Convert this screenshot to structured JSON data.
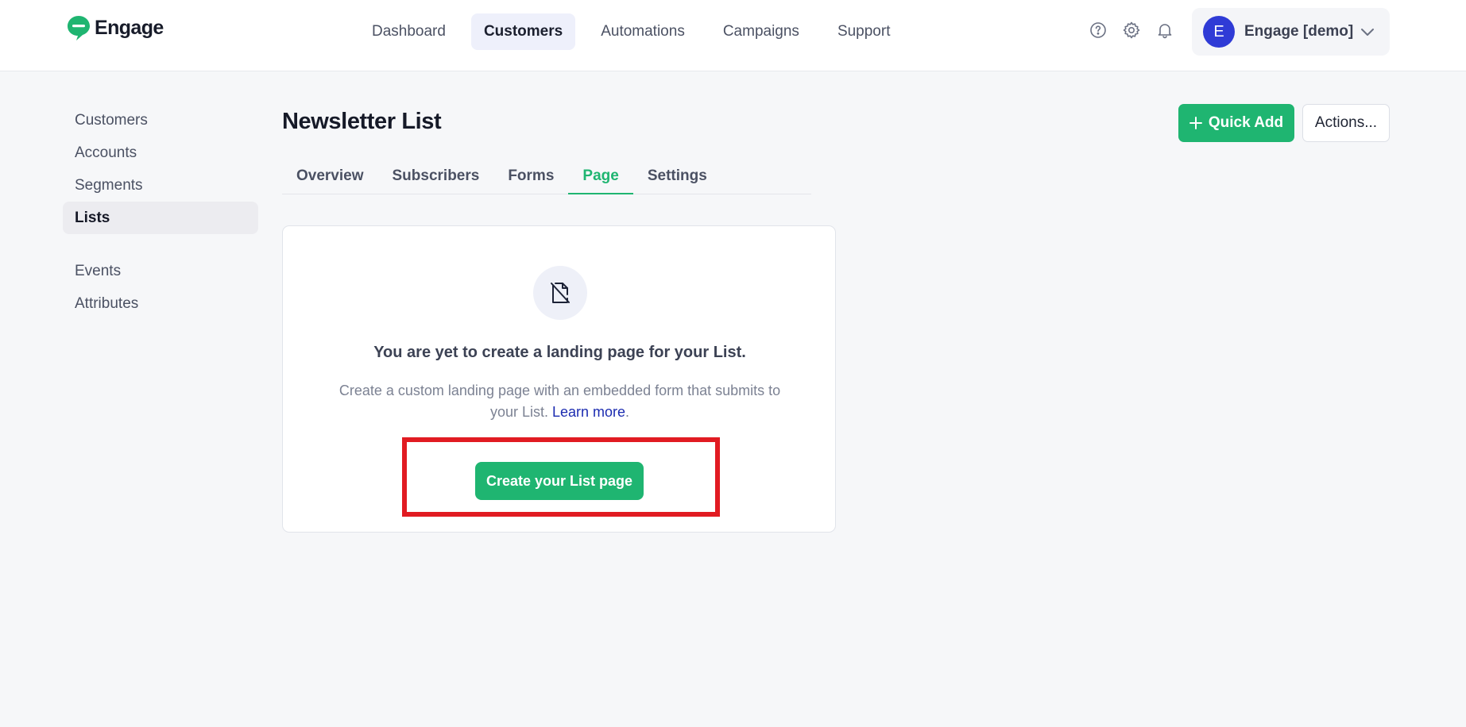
{
  "brand": {
    "name": "Engage",
    "color": "#1fb571"
  },
  "topnav": {
    "items": [
      {
        "label": "Dashboard",
        "active": false
      },
      {
        "label": "Customers",
        "active": true
      },
      {
        "label": "Automations",
        "active": false
      },
      {
        "label": "Campaigns",
        "active": false
      },
      {
        "label": "Support",
        "active": false
      }
    ]
  },
  "header_icons": [
    "help-icon",
    "gear-icon",
    "bell-icon"
  ],
  "account": {
    "initial": "E",
    "name": "Engage [demo]",
    "avatar_color": "#2f3bd6"
  },
  "sidebar": {
    "items": [
      {
        "label": "Customers",
        "active": false
      },
      {
        "label": "Accounts",
        "active": false
      },
      {
        "label": "Segments",
        "active": false
      },
      {
        "label": "Lists",
        "active": true
      }
    ],
    "secondary": [
      {
        "label": "Events"
      },
      {
        "label": "Attributes"
      }
    ]
  },
  "page": {
    "title": "Newsletter List",
    "quick_add_label": "Quick Add",
    "actions_label": "Actions..."
  },
  "tabs": [
    {
      "label": "Overview",
      "active": false
    },
    {
      "label": "Subscribers",
      "active": false
    },
    {
      "label": "Forms",
      "active": false
    },
    {
      "label": "Page",
      "active": true
    },
    {
      "label": "Settings",
      "active": false
    }
  ],
  "empty_state": {
    "icon": "no-page-icon",
    "title": "You are yet to create a landing page for your List.",
    "description_line1": "Create a custom landing page with an embedded form that submits to",
    "description_line2": "your List.",
    "learn_more": "Learn more",
    "period": ".",
    "cta_label": "Create your List page",
    "highlight_color": "#e11b22"
  }
}
